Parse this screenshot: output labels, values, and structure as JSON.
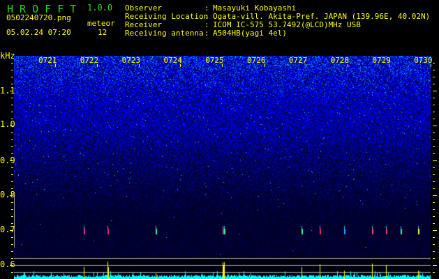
{
  "header": {
    "app_title": "H R O F F T",
    "version": "1.0.0",
    "filename": "0502240720.png",
    "datetime": "05.02.24 07:20",
    "meteor_label": "meteor",
    "meteor_count": "12"
  },
  "info": [
    {
      "label": "Observer",
      "value": "Masayuki Kobayashi"
    },
    {
      "label": "Receiving Location",
      "value": "Ogata-vill. Akita-Pref. JAPAN (139.96E, 40.02N)"
    },
    {
      "label": "Receiver",
      "value": "ICOM IC-575 53.7492(@LCD)MHz USB"
    },
    {
      "label": "Receiving antenna",
      "value": "A504HB(yagi 4el)"
    }
  ],
  "chart_data": {
    "type": "heatmap",
    "ylabel": "kHz",
    "y_ticks": [
      "1.1",
      "1.0",
      "0.9",
      "0.8",
      "0.7",
      "0.6"
    ],
    "x_ticks": [
      "0721",
      "0722",
      "0723",
      "0724",
      "0725",
      "0726",
      "0727",
      "0728",
      "0729",
      "0730"
    ],
    "ylim": [
      0.56,
      1.18
    ],
    "meteor_count": 12
  },
  "colors": {
    "text": "#ffff00",
    "title": "#22dd22",
    "signal": "#00ffff",
    "spike": "#ffff00",
    "grid": "#a0a0a0"
  }
}
